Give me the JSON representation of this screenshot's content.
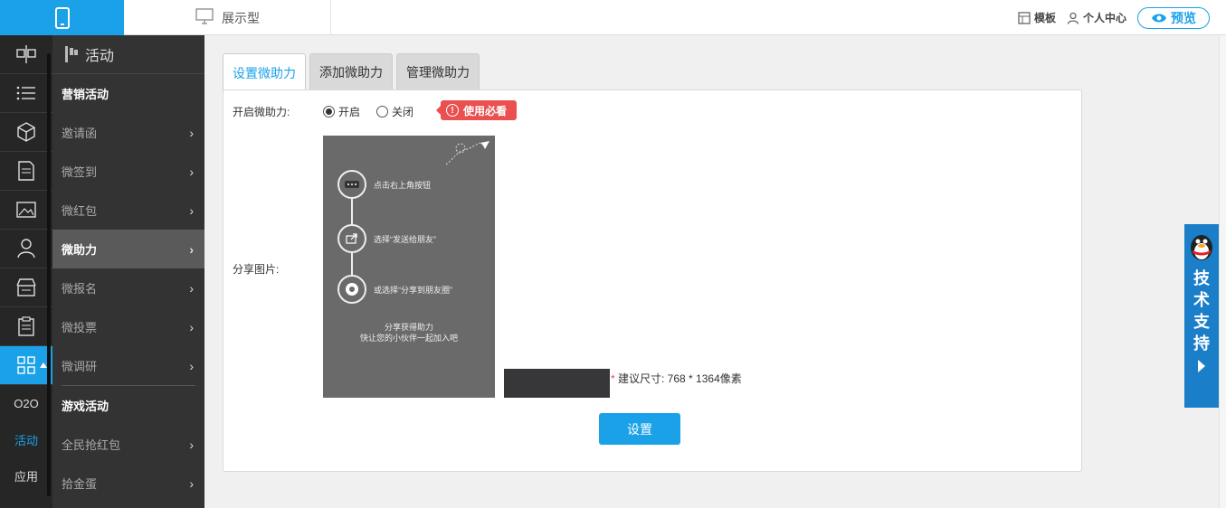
{
  "topbar": {
    "display_label": "展示型",
    "template_label": "模板",
    "user_center_label": "个人中心",
    "preview_label": "预览"
  },
  "rail": {
    "text_items": [
      "O2O",
      "活动",
      "应用"
    ],
    "active_text": "活动"
  },
  "submenu": {
    "title": "活动",
    "marketing_header": "营销活动",
    "marketing_items": [
      "邀请函",
      "微签到",
      "微红包",
      "微助力",
      "微报名",
      "微投票",
      "微调研"
    ],
    "active_item": "微助力",
    "game_header": "游戏活动",
    "game_items": [
      "全民抢红包",
      "拾金蛋"
    ]
  },
  "tabs": [
    "设置微助力",
    "添加微助力",
    "管理微助力"
  ],
  "form": {
    "enable_label": "开启微助力:",
    "radio_on": "开启",
    "radio_off": "关闭",
    "selected": "开启",
    "must_read": "使用必看",
    "share_image_label": "分享图片:",
    "steps": [
      "点击右上角按钮",
      "选择“发送给朋友”",
      "或选择“分享到朋友圈”"
    ],
    "caption_line1": "分享获得助力",
    "caption_line2": "快让您的小伙伴一起加入吧",
    "size_hint": "建议尺寸: 768 * 1364像素",
    "submit_label": "设置"
  },
  "support": {
    "chars": [
      "技",
      "术",
      "支",
      "持"
    ]
  },
  "colors": {
    "accent": "#1aa1e8",
    "danger": "#e9504f",
    "sidebar_bg": "#333333",
    "rail_bg": "#262626",
    "support_bg": "#1a7ec8"
  }
}
